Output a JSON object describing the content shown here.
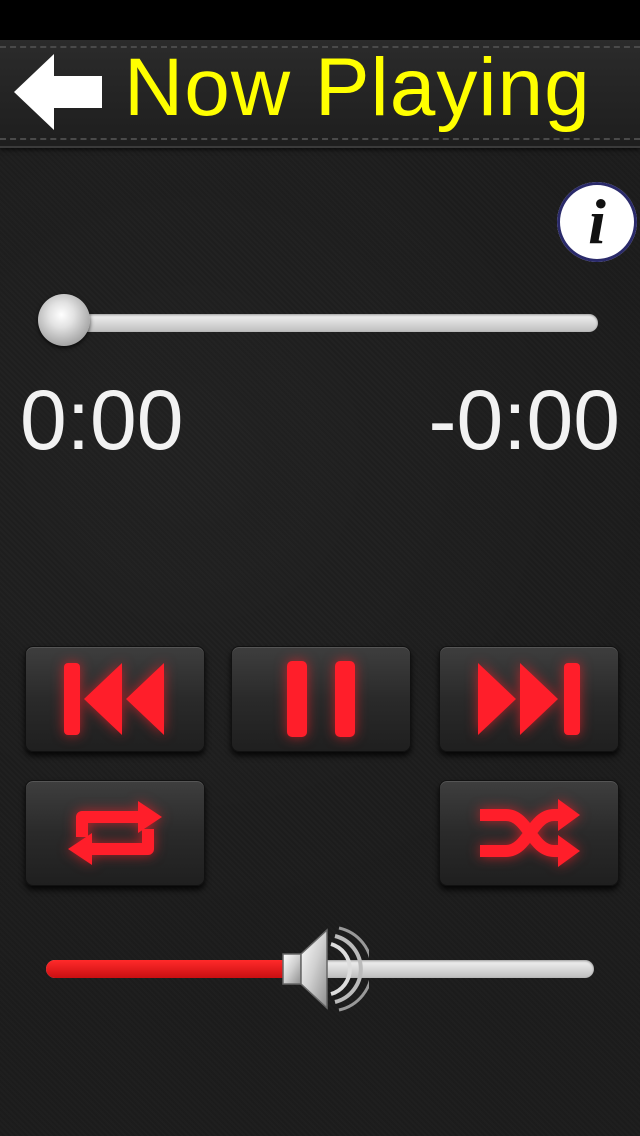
{
  "header": {
    "title": "Now Playing",
    "back_icon": "back-arrow-icon",
    "title_color": "#ffff00"
  },
  "info": {
    "label": "i",
    "icon": "info-icon"
  },
  "progress": {
    "elapsed": "0:00",
    "remaining": "-0:00",
    "value": 0
  },
  "controls": {
    "icons": [
      "previous-track-icon",
      "pause-icon",
      "next-track-icon",
      "repeat-icon",
      "shuffle-icon"
    ],
    "accent_color": "#e21b23"
  },
  "volume": {
    "level": 0.45,
    "icon": "speaker-icon"
  }
}
